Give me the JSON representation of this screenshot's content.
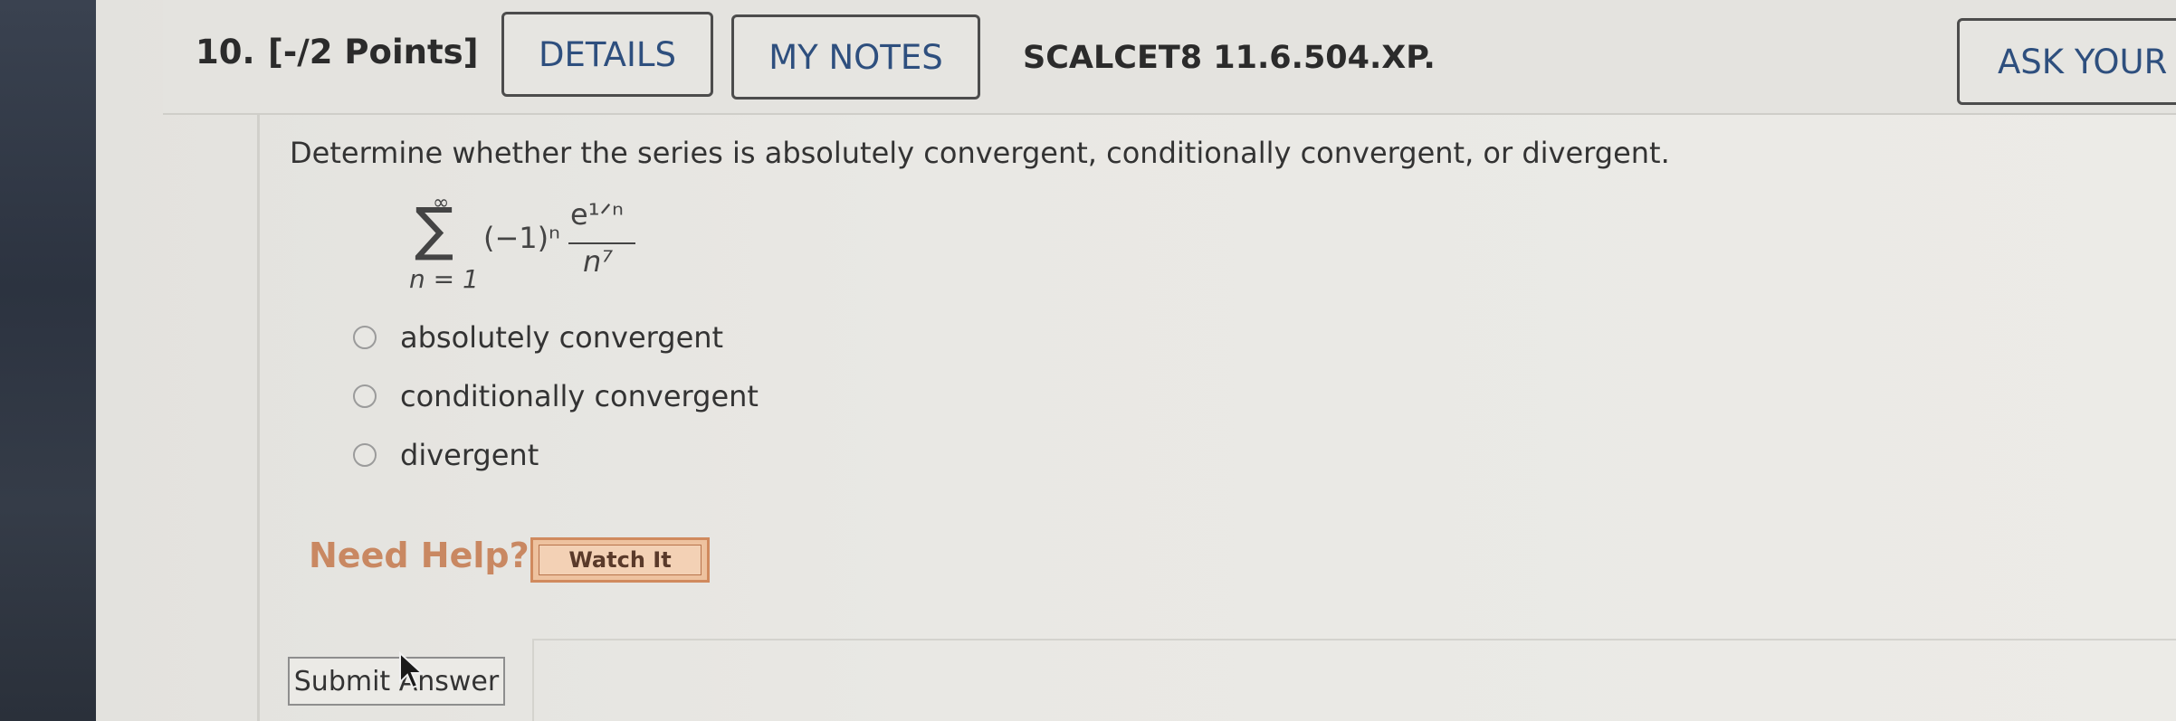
{
  "header": {
    "question_number": "10.",
    "points": "[-/2 Points]",
    "details_label": "DETAILS",
    "my_notes_label": "MY NOTES",
    "source": "SCALCET8 11.6.504.XP.",
    "ask_label": "ASK YOUR"
  },
  "question": {
    "prompt": "Determine whether the series is absolutely convergent, conditionally convergent, or divergent.",
    "series": {
      "upper": "∞",
      "sigma": "∑",
      "lower": "n = 1",
      "term": "(−1)ⁿ",
      "numerator": "e¹ᐟⁿ",
      "denominator": "n⁷"
    }
  },
  "options": [
    {
      "label": "absolutely convergent"
    },
    {
      "label": "conditionally convergent"
    },
    {
      "label": "divergent"
    }
  ],
  "help": {
    "label": "Need Help?",
    "watch_label": "Watch It"
  },
  "submit_label": "Submit Answer",
  "colors": {
    "link_blue": "#2e4f7e",
    "help_orange": "#c98862"
  }
}
